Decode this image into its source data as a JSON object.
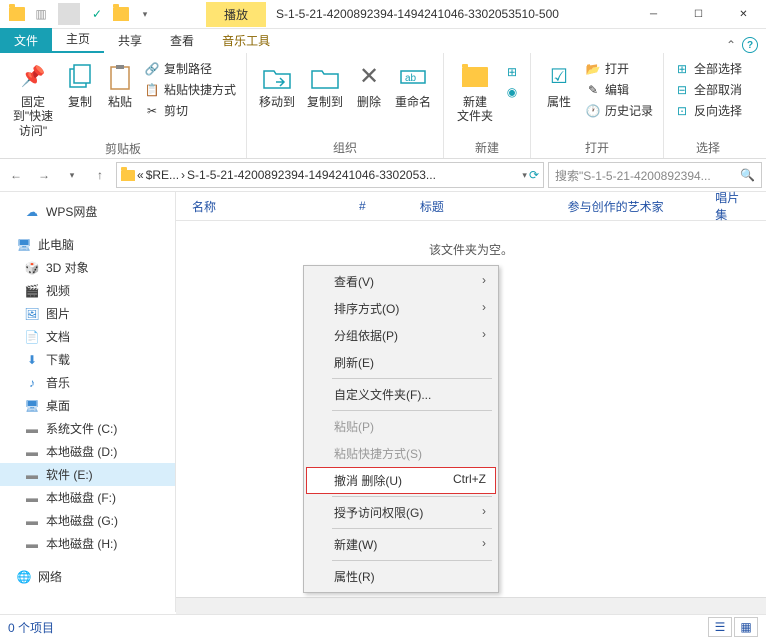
{
  "title": "S-1-5-21-4200892394-1494241046-3302053510-500",
  "play_tab": "播放",
  "tabs": {
    "file": "文件",
    "home": "主页",
    "share": "共享",
    "view": "查看",
    "music": "音乐工具"
  },
  "ribbon": {
    "clipboard": {
      "label": "剪贴板",
      "pin": "固定到\"快速访问\"",
      "copy": "复制",
      "paste": "粘贴",
      "copypath": "复制路径",
      "pasteshortcut": "粘贴快捷方式",
      "cut": "剪切"
    },
    "organize": {
      "label": "组织",
      "moveto": "移动到",
      "copyto": "复制到",
      "delete": "删除",
      "rename": "重命名"
    },
    "new": {
      "label": "新建",
      "newfolder": "新建\n文件夹"
    },
    "open": {
      "label": "打开",
      "properties": "属性",
      "open": "打开",
      "edit": "编辑",
      "history": "历史记录"
    },
    "select": {
      "label": "选择",
      "selectall": "全部选择",
      "selectnone": "全部取消",
      "invert": "反向选择"
    }
  },
  "breadcrumb": {
    "part1": "$RE...",
    "part2": "S-1-5-21-4200892394-1494241046-3302053...",
    "sep": "›"
  },
  "search_placeholder": "搜索\"S-1-5-21-4200892394...",
  "columns": {
    "name": "名称",
    "num": "#",
    "title": "标题",
    "artist": "参与创作的艺术家",
    "album": "唱片集"
  },
  "empty": "该文件夹为空。",
  "nav": {
    "wps": "WPS网盘",
    "thispc": "此电脑",
    "obj3d": "3D 对象",
    "video": "视频",
    "pictures": "图片",
    "docs": "文档",
    "downloads": "下载",
    "music": "音乐",
    "desktop": "桌面",
    "sysc": "系统文件 (C:)",
    "locald": "本地磁盘 (D:)",
    "softe": "软件 (E:)",
    "localf": "本地磁盘 (F:)",
    "localg": "本地磁盘 (G:)",
    "localh": "本地磁盘 (H:)",
    "network": "网络"
  },
  "context": {
    "view": "查看(V)",
    "sort": "排序方式(O)",
    "group": "分组依据(P)",
    "refresh": "刷新(E)",
    "customize": "自定义文件夹(F)...",
    "paste": "粘贴(P)",
    "pasteshortcut": "粘贴快捷方式(S)",
    "undo": "撤消 删除(U)",
    "undo_key": "Ctrl+Z",
    "access": "授予访问权限(G)",
    "new": "新建(W)",
    "properties": "属性(R)"
  },
  "status": "0 个项目"
}
